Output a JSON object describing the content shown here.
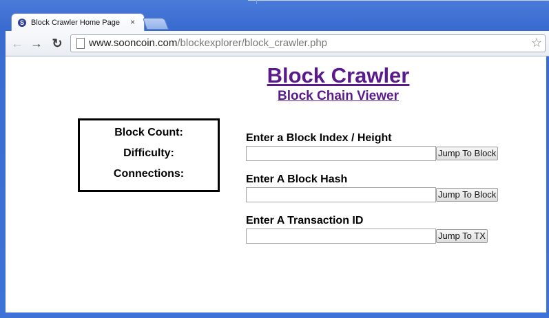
{
  "browser": {
    "tab": {
      "favicon_letter": "S",
      "title": "Block Crawler Home Page",
      "close": "×"
    },
    "toolbar": {
      "back": "←",
      "forward": "→",
      "reload": "↻",
      "url_host": "www.sooncoin.com",
      "url_path": "/blockexplorer/block_crawler.php",
      "star": "☆"
    }
  },
  "page": {
    "title": "Block Crawler",
    "subtitle": "Block Chain Viewer",
    "stats": {
      "block_count_label": "Block Count:",
      "difficulty_label": "Difficulty:",
      "connections_label": "Connections:"
    },
    "forms": [
      {
        "label": "Enter a Block Index / Height",
        "value": "",
        "button": "Jump To Block"
      },
      {
        "label": "Enter A Block Hash",
        "value": "",
        "button": "Jump To Block"
      },
      {
        "label": "Enter A Transaction ID",
        "value": "",
        "button": "Jump To TX"
      }
    ]
  },
  "colors": {
    "link": "#5a1a8c",
    "frame": "#3f72d6"
  }
}
